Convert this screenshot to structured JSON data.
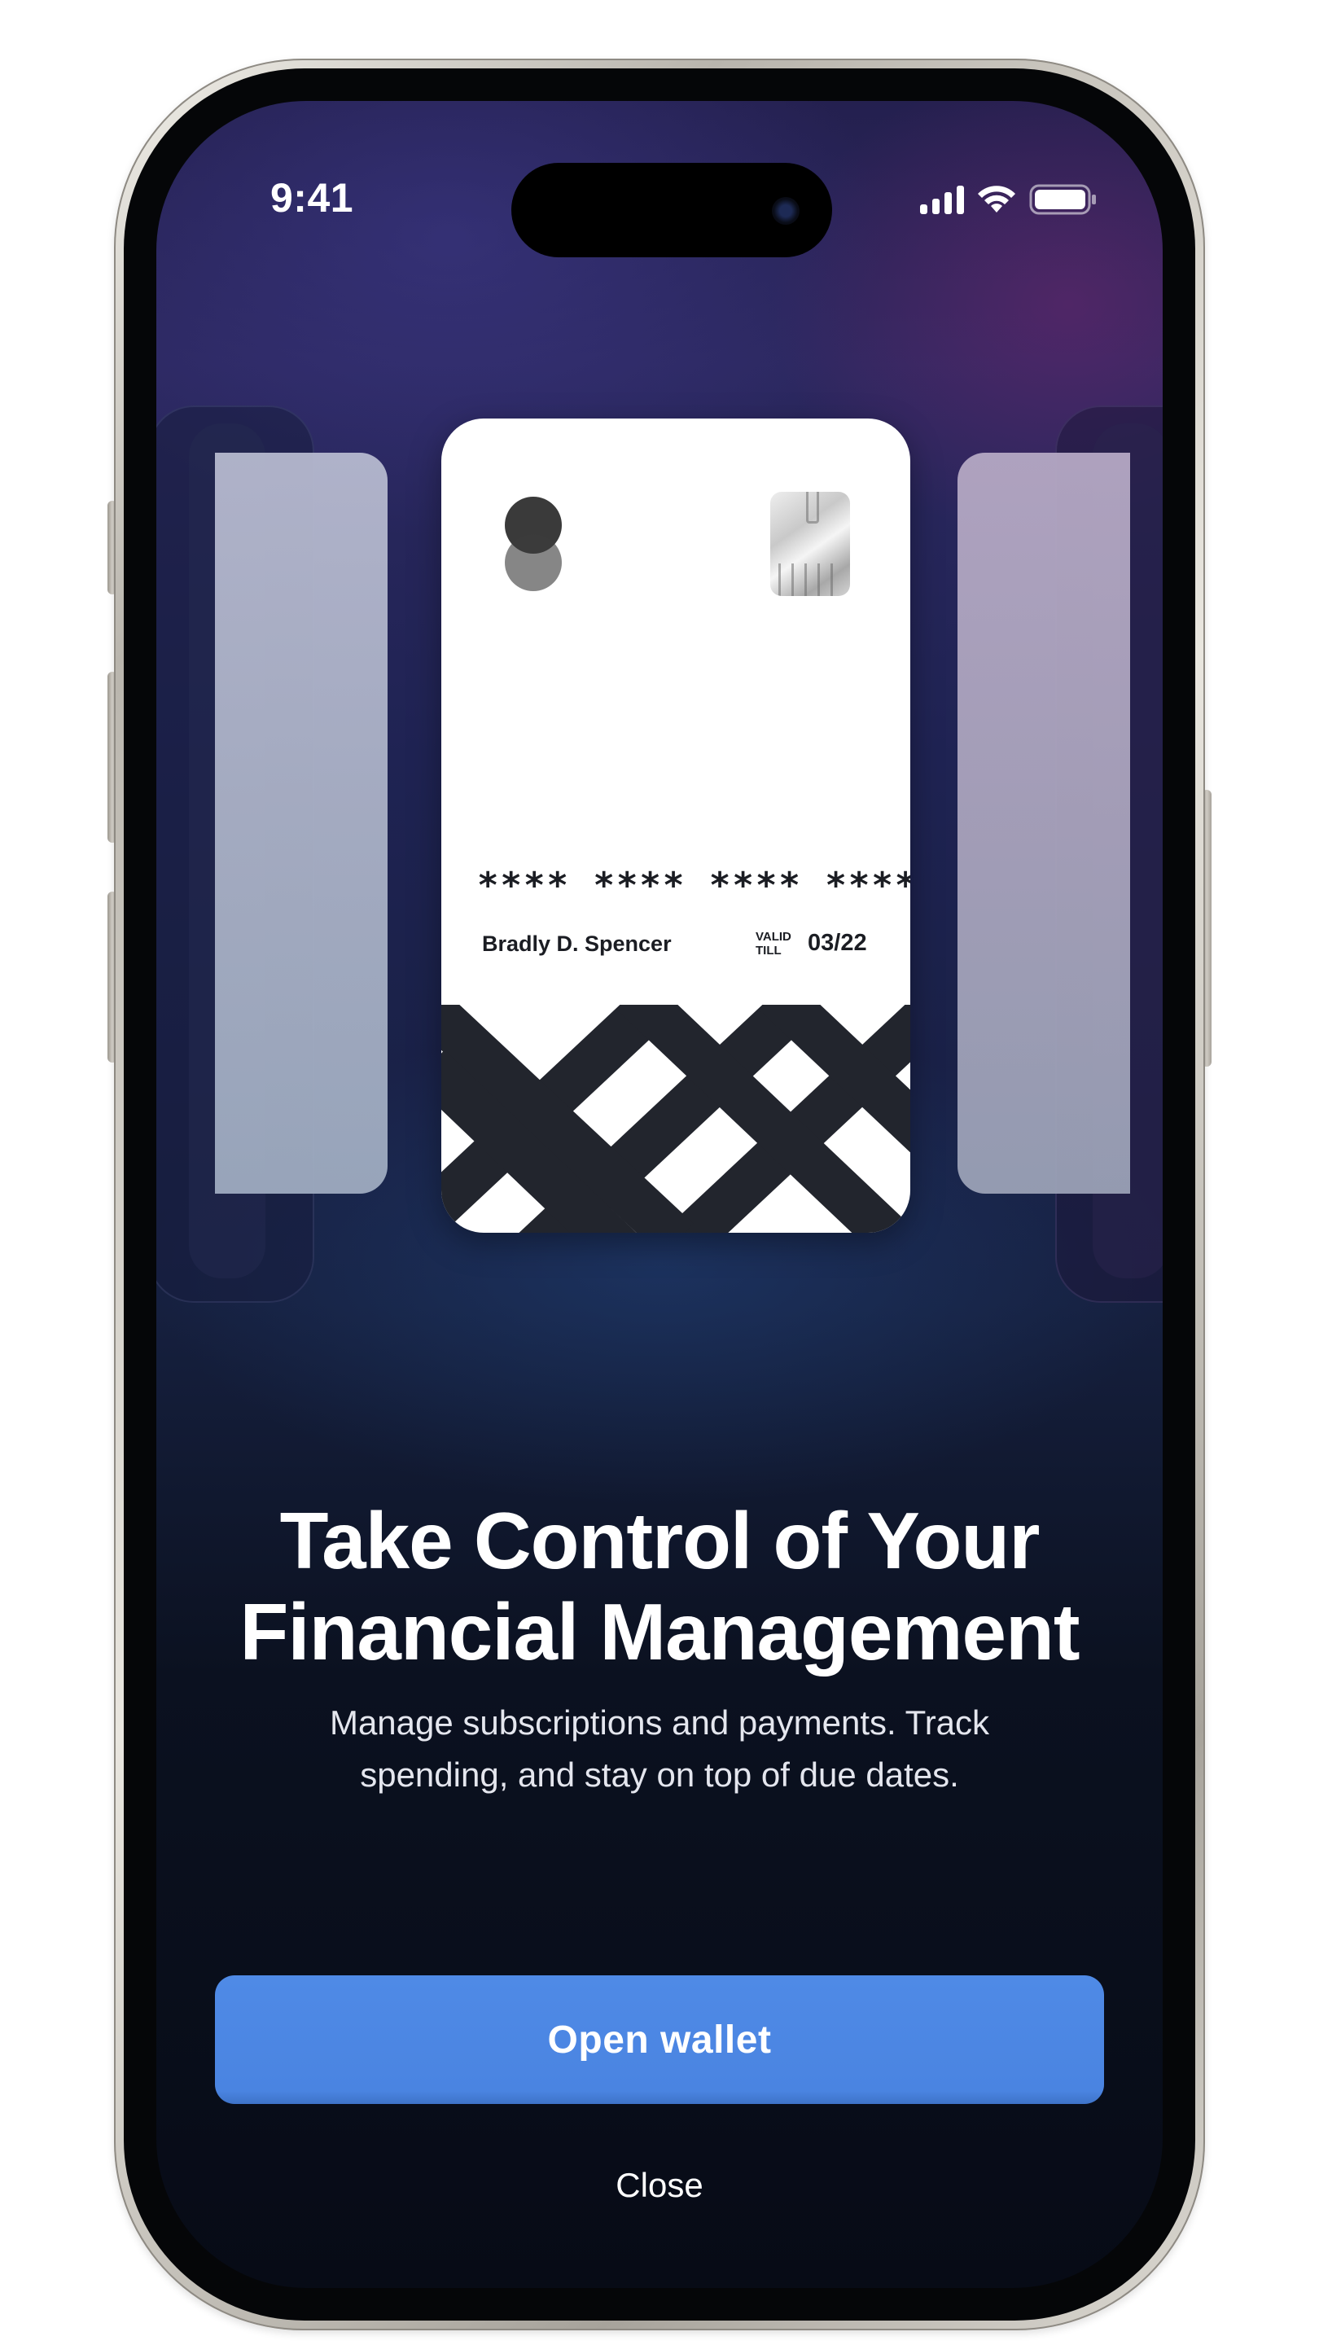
{
  "status_bar": {
    "time": "9:41",
    "icons": [
      "cellular-signal-icon",
      "wifi-icon",
      "battery-icon"
    ]
  },
  "card": {
    "number_masked": "**** **** **** ****",
    "holder_name": "Bradly D. Spencer",
    "valid_label_line1": "VALID",
    "valid_label_line2": "TILL",
    "expiry": "03/22",
    "brand_icon": "brand-circles-icon",
    "chip_icon": "sim-chip-icon"
  },
  "onboarding": {
    "headline_line1": "Take Control of Your",
    "headline_line2": "Financial Management",
    "subtitle_line1": "Manage subscriptions and payments. Track",
    "subtitle_line2": "spending, and stay on top of due dates."
  },
  "actions": {
    "primary_label": "Open wallet",
    "secondary_label": "Close"
  },
  "colors": {
    "accent": "#4A84E1",
    "card_background": "#FFFFFF",
    "card_pattern": "#22252D",
    "screen_background": "#0B1120"
  }
}
